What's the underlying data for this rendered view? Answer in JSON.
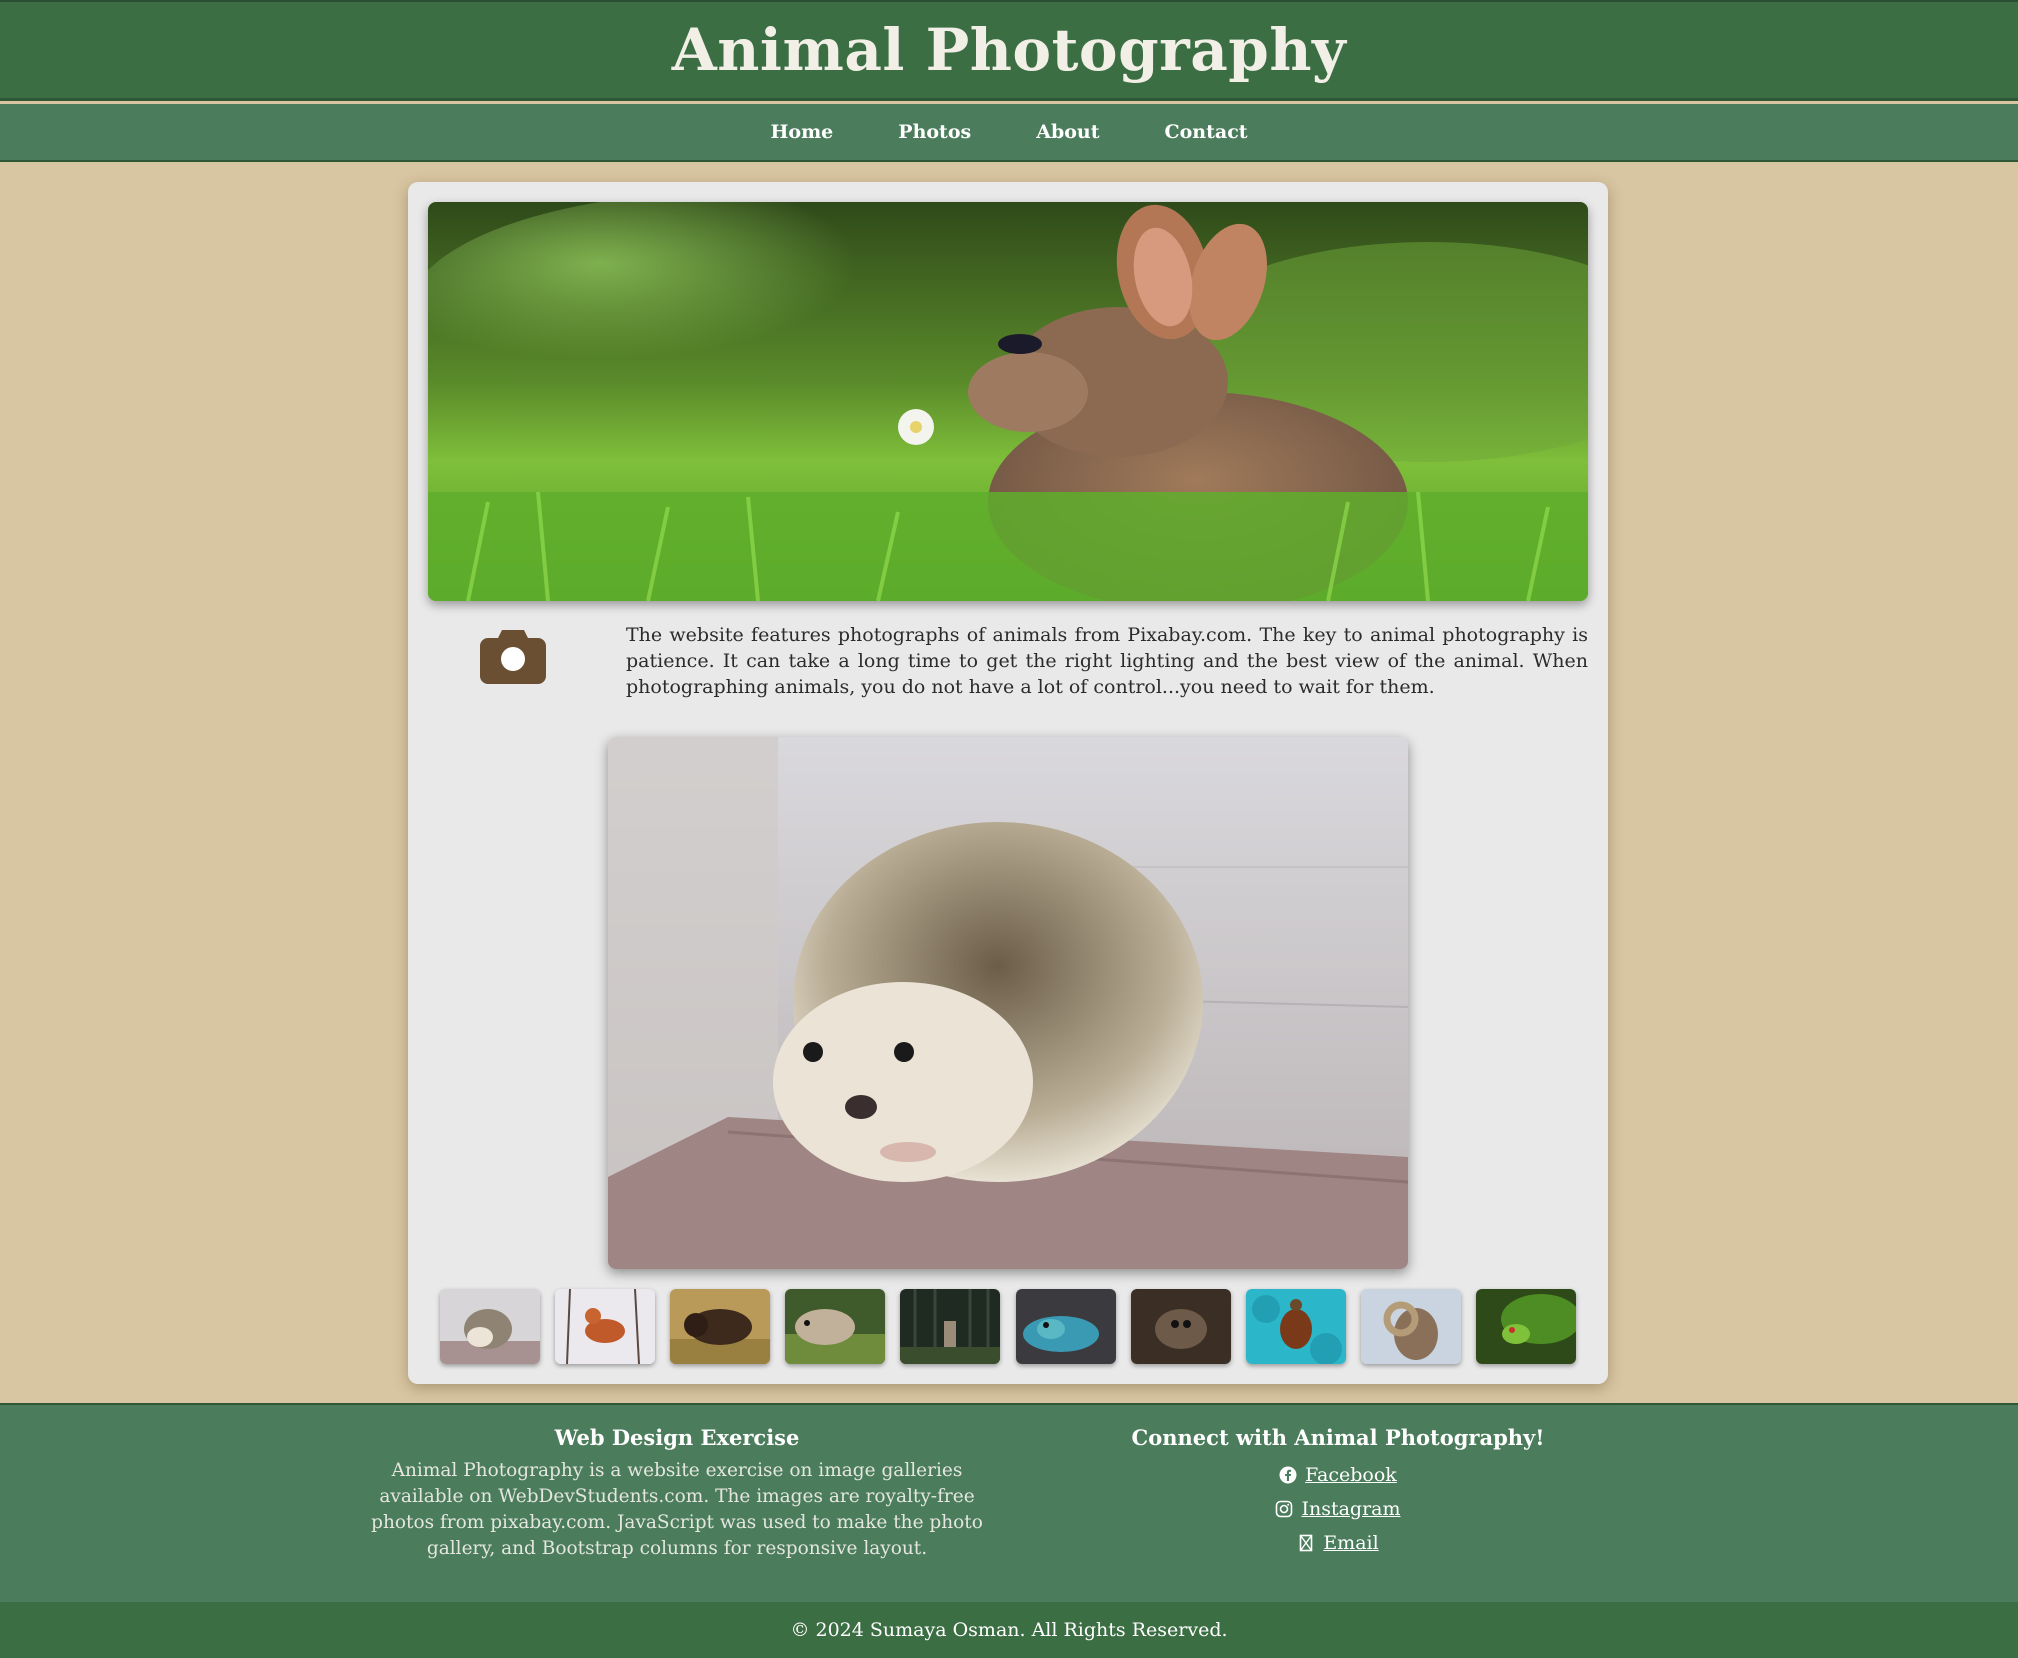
{
  "header": {
    "title": "Animal Photography"
  },
  "nav": {
    "items": [
      {
        "label": "Home"
      },
      {
        "label": "Photos"
      },
      {
        "label": "About"
      },
      {
        "label": "Contact"
      }
    ]
  },
  "main": {
    "hero_image": {
      "subject": "rabbit in grass"
    },
    "intro_icon": "camera-icon",
    "intro_text": "The website features photographs of animals from Pixabay.com. The key to animal photography is patience. It can take a long time to get the right lighting and the best view of the animal. When photographing animals, you do not have a lot of control...you need to wait for them.",
    "featured_photo": {
      "subject": "hedgehog"
    },
    "thumbnails": [
      {
        "subject": "hedgehog"
      },
      {
        "subject": "fox"
      },
      {
        "subject": "bison"
      },
      {
        "subject": "otter"
      },
      {
        "subject": "deer"
      },
      {
        "subject": "lizard"
      },
      {
        "subject": "spider"
      },
      {
        "subject": "sea turtle"
      },
      {
        "subject": "ram"
      },
      {
        "subject": "frog"
      }
    ]
  },
  "footer": {
    "left_heading": "Web Design Exercise",
    "left_text": "Animal Photography is a website exercise on image galleries available on WebDevStudents.com. The images are royalty-free photos from pixabay.com. JavaScript was used to make the photo gallery, and Bootstrap columns for responsive layout.",
    "right_heading": "Connect with Animal Photography!",
    "social": [
      {
        "label": "Facebook",
        "icon": "facebook-icon"
      },
      {
        "label": "Instagram",
        "icon": "instagram-icon"
      },
      {
        "label": "Email",
        "icon": "email-icon"
      }
    ],
    "copyright": "© 2024 Sumaya Osman. All Rights Reserved."
  },
  "colors": {
    "header_bg": "#3c6e44",
    "nav_bg": "#4b7d5c",
    "page_bg": "#d8c5a1",
    "card_bg": "#e9e9e9",
    "accent_brown": "#6b4f33"
  }
}
